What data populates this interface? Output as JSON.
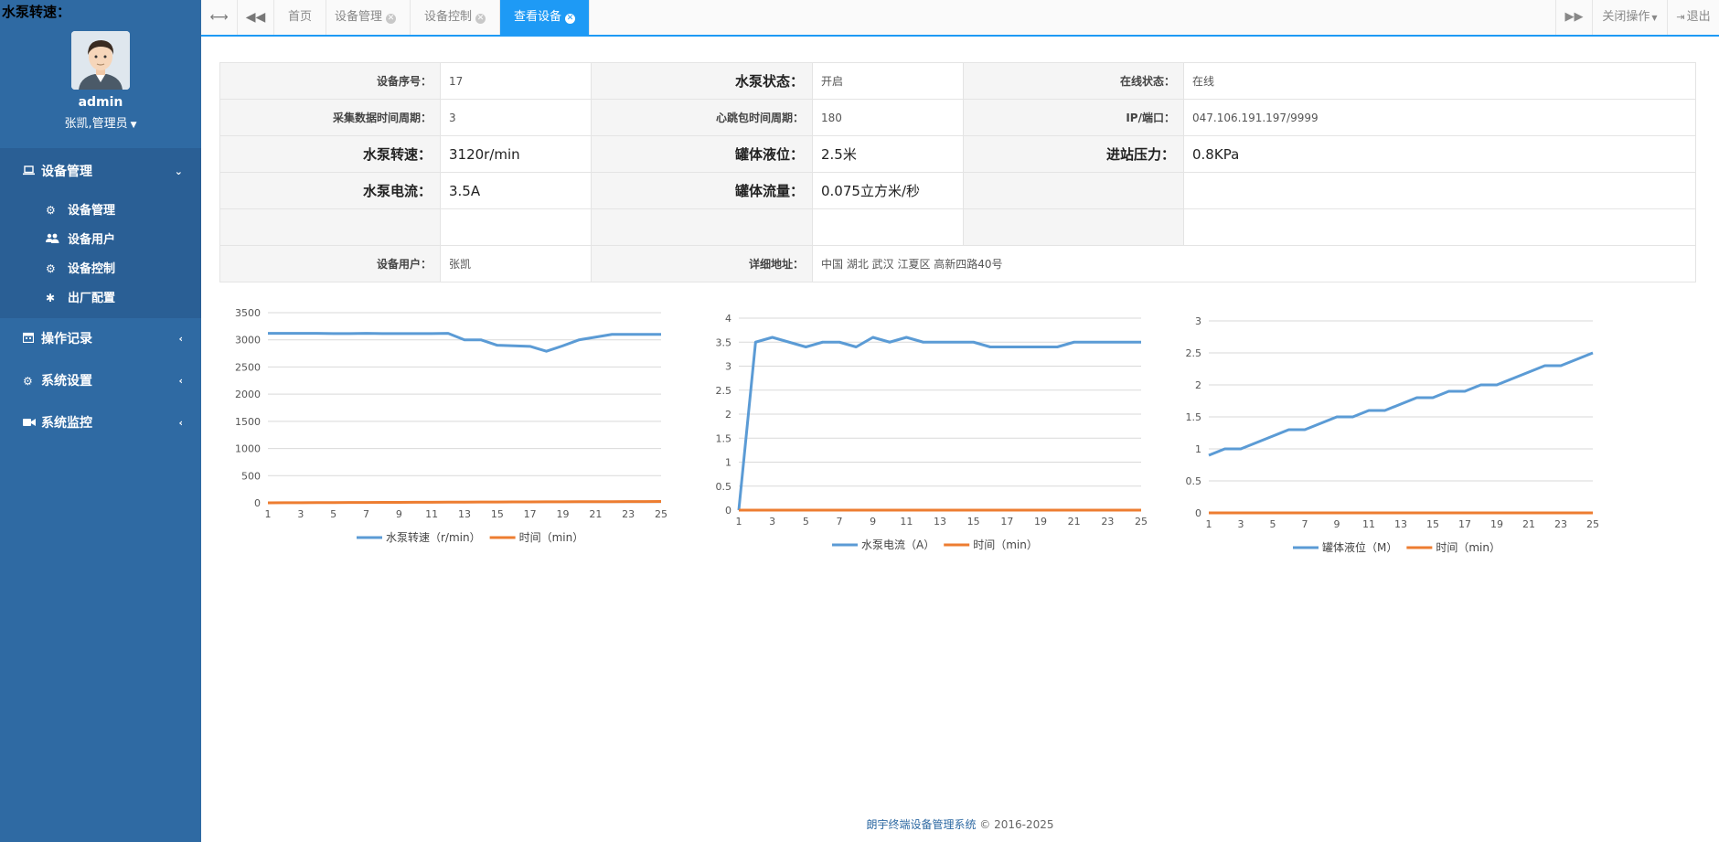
{
  "corner_title": "水泵转速：",
  "user": {
    "name": "admin",
    "role": "张凯,管理员"
  },
  "sidebar": {
    "groups": [
      {
        "label": "设备管理",
        "icon": "laptop-icon",
        "expanded": true,
        "items": [
          {
            "label": "设备管理",
            "icon": "gear-icon"
          },
          {
            "label": "设备用户",
            "icon": "users-icon"
          },
          {
            "label": "设备控制",
            "icon": "gears-icon"
          },
          {
            "label": "出厂配置",
            "icon": "asterisk-icon"
          }
        ]
      },
      {
        "label": "操作记录",
        "icon": "calendar-icon",
        "expanded": false
      },
      {
        "label": "系统设置",
        "icon": "gear-icon",
        "expanded": false
      },
      {
        "label": "系统监控",
        "icon": "video-camera-icon",
        "expanded": false
      }
    ]
  },
  "topbar": {
    "tabs": [
      {
        "label": "首页",
        "closable": false,
        "active": false
      },
      {
        "label": "设备管理",
        "closable": true,
        "active": false
      },
      {
        "label": "设备控制",
        "closable": true,
        "active": false
      },
      {
        "label": "查看设备",
        "closable": true,
        "active": true
      }
    ],
    "close_ops": "关闭操作",
    "logout": "退出"
  },
  "info": {
    "device_no_label": "设备序号：",
    "device_no": "17",
    "pump_status_label": "水泵状态：",
    "pump_status": "开启",
    "online_label": "在线状态：",
    "online": "在线",
    "collect_label": "采集数据时间周期：",
    "collect": "3",
    "heartbeat_label": "心跳包时间周期：",
    "heartbeat": "180",
    "ip_label": "IP/端口：",
    "ip": "047.106.191.197/9999",
    "speed_label": "水泵转速：",
    "speed": "3120r/min",
    "level_label": "罐体液位：",
    "level": "2.5米",
    "pressure_label": "进站压力：",
    "pressure": "0.8KPa",
    "current_label": "水泵电流：",
    "current": "3.5A",
    "flow_label": "罐体流量：",
    "flow": "0.075立方米/秒",
    "user_label": "设备用户：",
    "user": "张凯",
    "address_label": "详细地址：",
    "address": "中国 湖北 武汉 江夏区 高新四路40号"
  },
  "chart_data": [
    {
      "type": "line",
      "x": [
        1,
        2,
        3,
        4,
        5,
        6,
        7,
        8,
        9,
        10,
        11,
        12,
        13,
        14,
        15,
        16,
        17,
        18,
        19,
        20,
        21,
        22,
        23,
        24,
        25
      ],
      "xticks": [
        1,
        3,
        5,
        7,
        9,
        11,
        13,
        15,
        17,
        19,
        21,
        23,
        25
      ],
      "ylim": [
        0,
        3500
      ],
      "yticks": [
        0,
        500,
        1000,
        1500,
        2000,
        2500,
        3000,
        3500
      ],
      "series": [
        {
          "name": "水泵转速（r/min）",
          "color": "#5b9bd5",
          "values": [
            3120,
            3120,
            3120,
            3120,
            3115,
            3115,
            3120,
            3115,
            3115,
            3115,
            3115,
            3120,
            3000,
            3000,
            2900,
            2890,
            2880,
            2790,
            2890,
            3000,
            3050,
            3100,
            3100,
            3100,
            3100
          ]
        },
        {
          "name": "时间（min）",
          "color": "#ed7d31",
          "values": [
            1,
            2,
            3,
            4,
            5,
            6,
            7,
            8,
            9,
            10,
            11,
            12,
            13,
            14,
            15,
            16,
            17,
            18,
            19,
            20,
            21,
            22,
            23,
            24,
            25
          ]
        }
      ]
    },
    {
      "type": "line",
      "x": [
        1,
        2,
        3,
        4,
        5,
        6,
        7,
        8,
        9,
        10,
        11,
        12,
        13,
        14,
        15,
        16,
        17,
        18,
        19,
        20,
        21,
        22,
        23,
        24,
        25
      ],
      "xticks": [
        1,
        3,
        5,
        7,
        9,
        11,
        13,
        15,
        17,
        19,
        21,
        23,
        25
      ],
      "ylim": [
        0,
        4
      ],
      "yticks": [
        0,
        0.5,
        1,
        1.5,
        2,
        2.5,
        3,
        3.5,
        4
      ],
      "series": [
        {
          "name": "水泵电流（A）",
          "color": "#5b9bd5",
          "values": [
            0,
            3.5,
            3.6,
            3.5,
            3.4,
            3.5,
            3.5,
            3.4,
            3.6,
            3.5,
            3.6,
            3.5,
            3.5,
            3.5,
            3.5,
            3.4,
            3.4,
            3.4,
            3.4,
            3.4,
            3.5,
            3.5,
            3.5,
            3.5,
            3.5
          ]
        },
        {
          "name": "时间（min）",
          "color": "#ed7d31",
          "values": [
            0,
            0,
            0,
            0,
            0,
            0,
            0,
            0,
            0,
            0,
            0,
            0,
            0,
            0,
            0,
            0,
            0,
            0,
            0,
            0,
            0,
            0,
            0,
            0,
            0
          ]
        }
      ]
    },
    {
      "type": "line",
      "x": [
        1,
        2,
        3,
        4,
        5,
        6,
        7,
        8,
        9,
        10,
        11,
        12,
        13,
        14,
        15,
        16,
        17,
        18,
        19,
        20,
        21,
        22,
        23,
        24,
        25
      ],
      "xticks": [
        1,
        3,
        5,
        7,
        9,
        11,
        13,
        15,
        17,
        19,
        21,
        23,
        25
      ],
      "ylim": [
        0,
        3
      ],
      "yticks": [
        0,
        0.5,
        1,
        1.5,
        2,
        2.5,
        3
      ],
      "series": [
        {
          "name": "罐体液位（M）",
          "color": "#5b9bd5",
          "values": [
            0.9,
            1.0,
            1.0,
            1.1,
            1.2,
            1.3,
            1.3,
            1.4,
            1.5,
            1.5,
            1.6,
            1.6,
            1.7,
            1.8,
            1.8,
            1.9,
            1.9,
            2.0,
            2.0,
            2.1,
            2.2,
            2.3,
            2.3,
            2.4,
            2.5
          ]
        },
        {
          "name": "时间（min）",
          "color": "#ed7d31",
          "values": [
            0,
            0,
            0,
            0,
            0,
            0,
            0,
            0,
            0,
            0,
            0,
            0,
            0,
            0,
            0,
            0,
            0,
            0,
            0,
            0,
            0,
            0,
            0,
            0,
            0
          ]
        }
      ]
    }
  ],
  "footer": {
    "brand": "朗宇终端设备管理系统",
    "copyright": "© 2016-2025"
  },
  "colors": {
    "sidebar": "#2f6aa3",
    "accent": "#1e9af5"
  }
}
